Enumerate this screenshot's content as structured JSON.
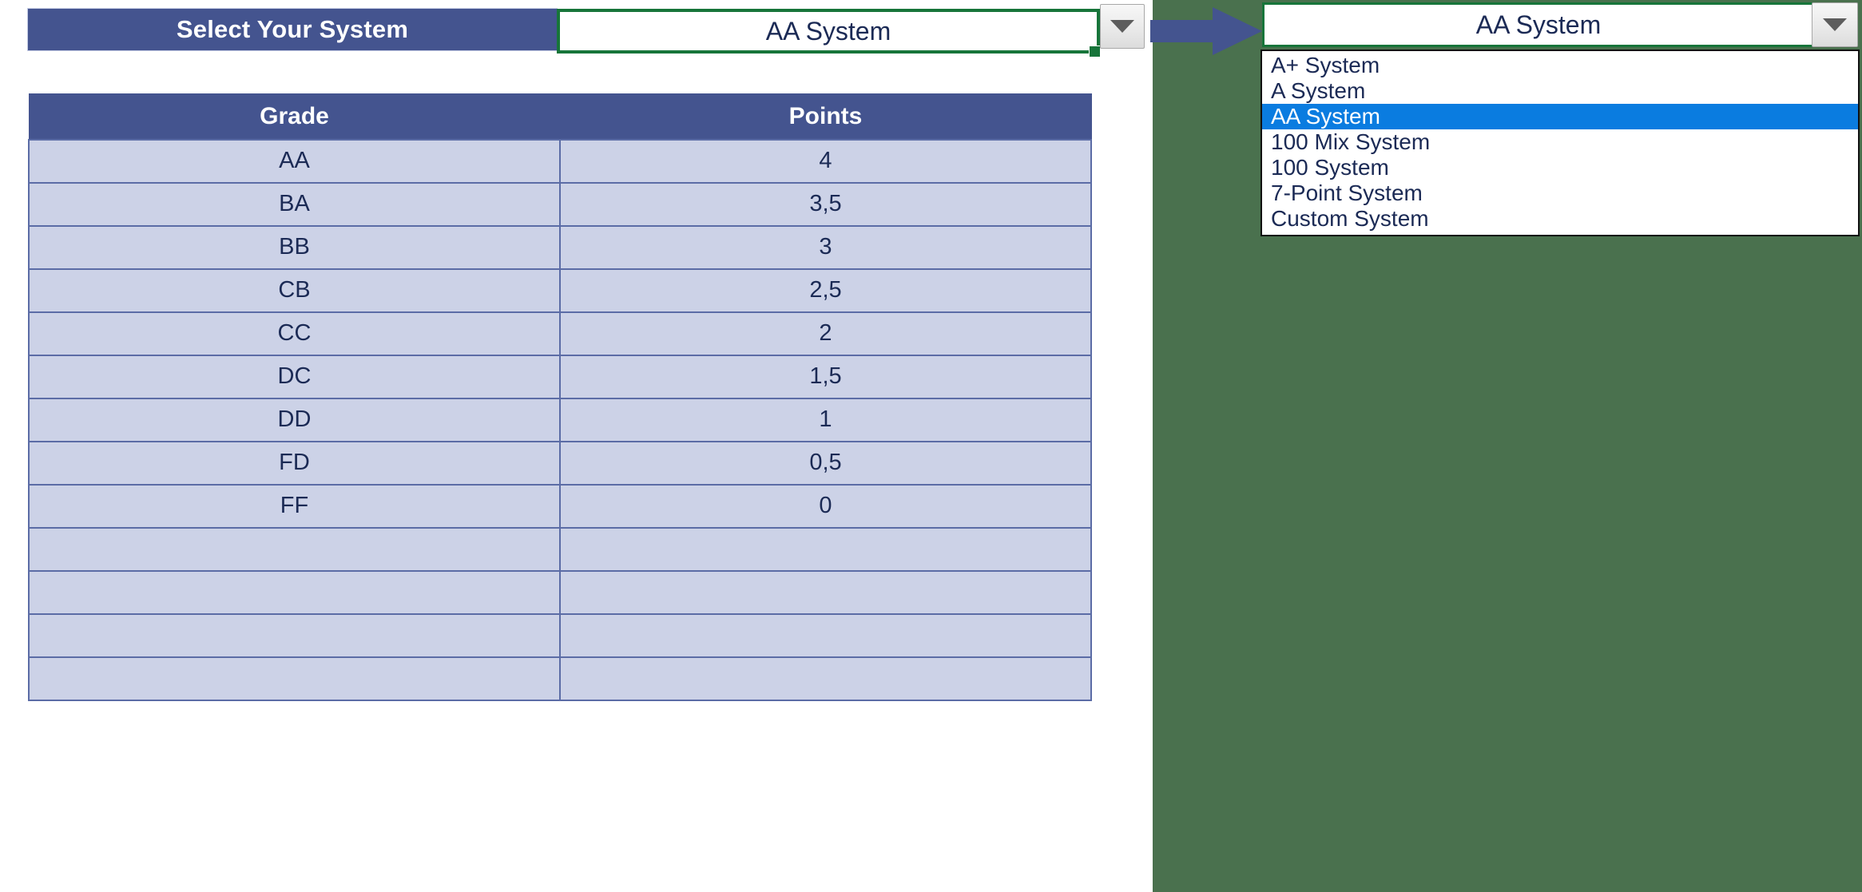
{
  "app": {
    "background_color": "#4a714e",
    "panel_background": "#ffffff"
  },
  "selector": {
    "label": "Select Your System",
    "label_band_color": "#44548f",
    "selected_value": "AA System",
    "cell_border_color": "#17753a",
    "dropdown_icon": "chevron-down-icon"
  },
  "dropdown": {
    "selected_value": "AA System",
    "highlight_color": "#0a7ce0",
    "dropdown_icon": "chevron-down-icon",
    "options": [
      {
        "label": "A+ System",
        "selected": false
      },
      {
        "label": "A System",
        "selected": false
      },
      {
        "label": "AA System",
        "selected": true
      },
      {
        "label": "100 Mix System",
        "selected": false
      },
      {
        "label": "100 System",
        "selected": false
      },
      {
        "label": "7-Point System",
        "selected": false
      },
      {
        "label": "Custom System",
        "selected": false
      }
    ]
  },
  "arrow": {
    "name": "right-arrow-icon",
    "color": "#44548f"
  },
  "table": {
    "header_color": "#44548f",
    "row_color": "#ccd2e7",
    "columns": [
      "Grade",
      "Points"
    ],
    "rows": [
      {
        "grade": "AA",
        "points": "4"
      },
      {
        "grade": "BA",
        "points": "3,5"
      },
      {
        "grade": "BB",
        "points": "3"
      },
      {
        "grade": "CB",
        "points": "2,5"
      },
      {
        "grade": "CC",
        "points": "2"
      },
      {
        "grade": "DC",
        "points": "1,5"
      },
      {
        "grade": "DD",
        "points": "1"
      },
      {
        "grade": "FD",
        "points": "0,5"
      },
      {
        "grade": "FF",
        "points": "0"
      },
      {
        "grade": "",
        "points": ""
      },
      {
        "grade": "",
        "points": ""
      },
      {
        "grade": "",
        "points": ""
      },
      {
        "grade": "",
        "points": ""
      }
    ]
  }
}
